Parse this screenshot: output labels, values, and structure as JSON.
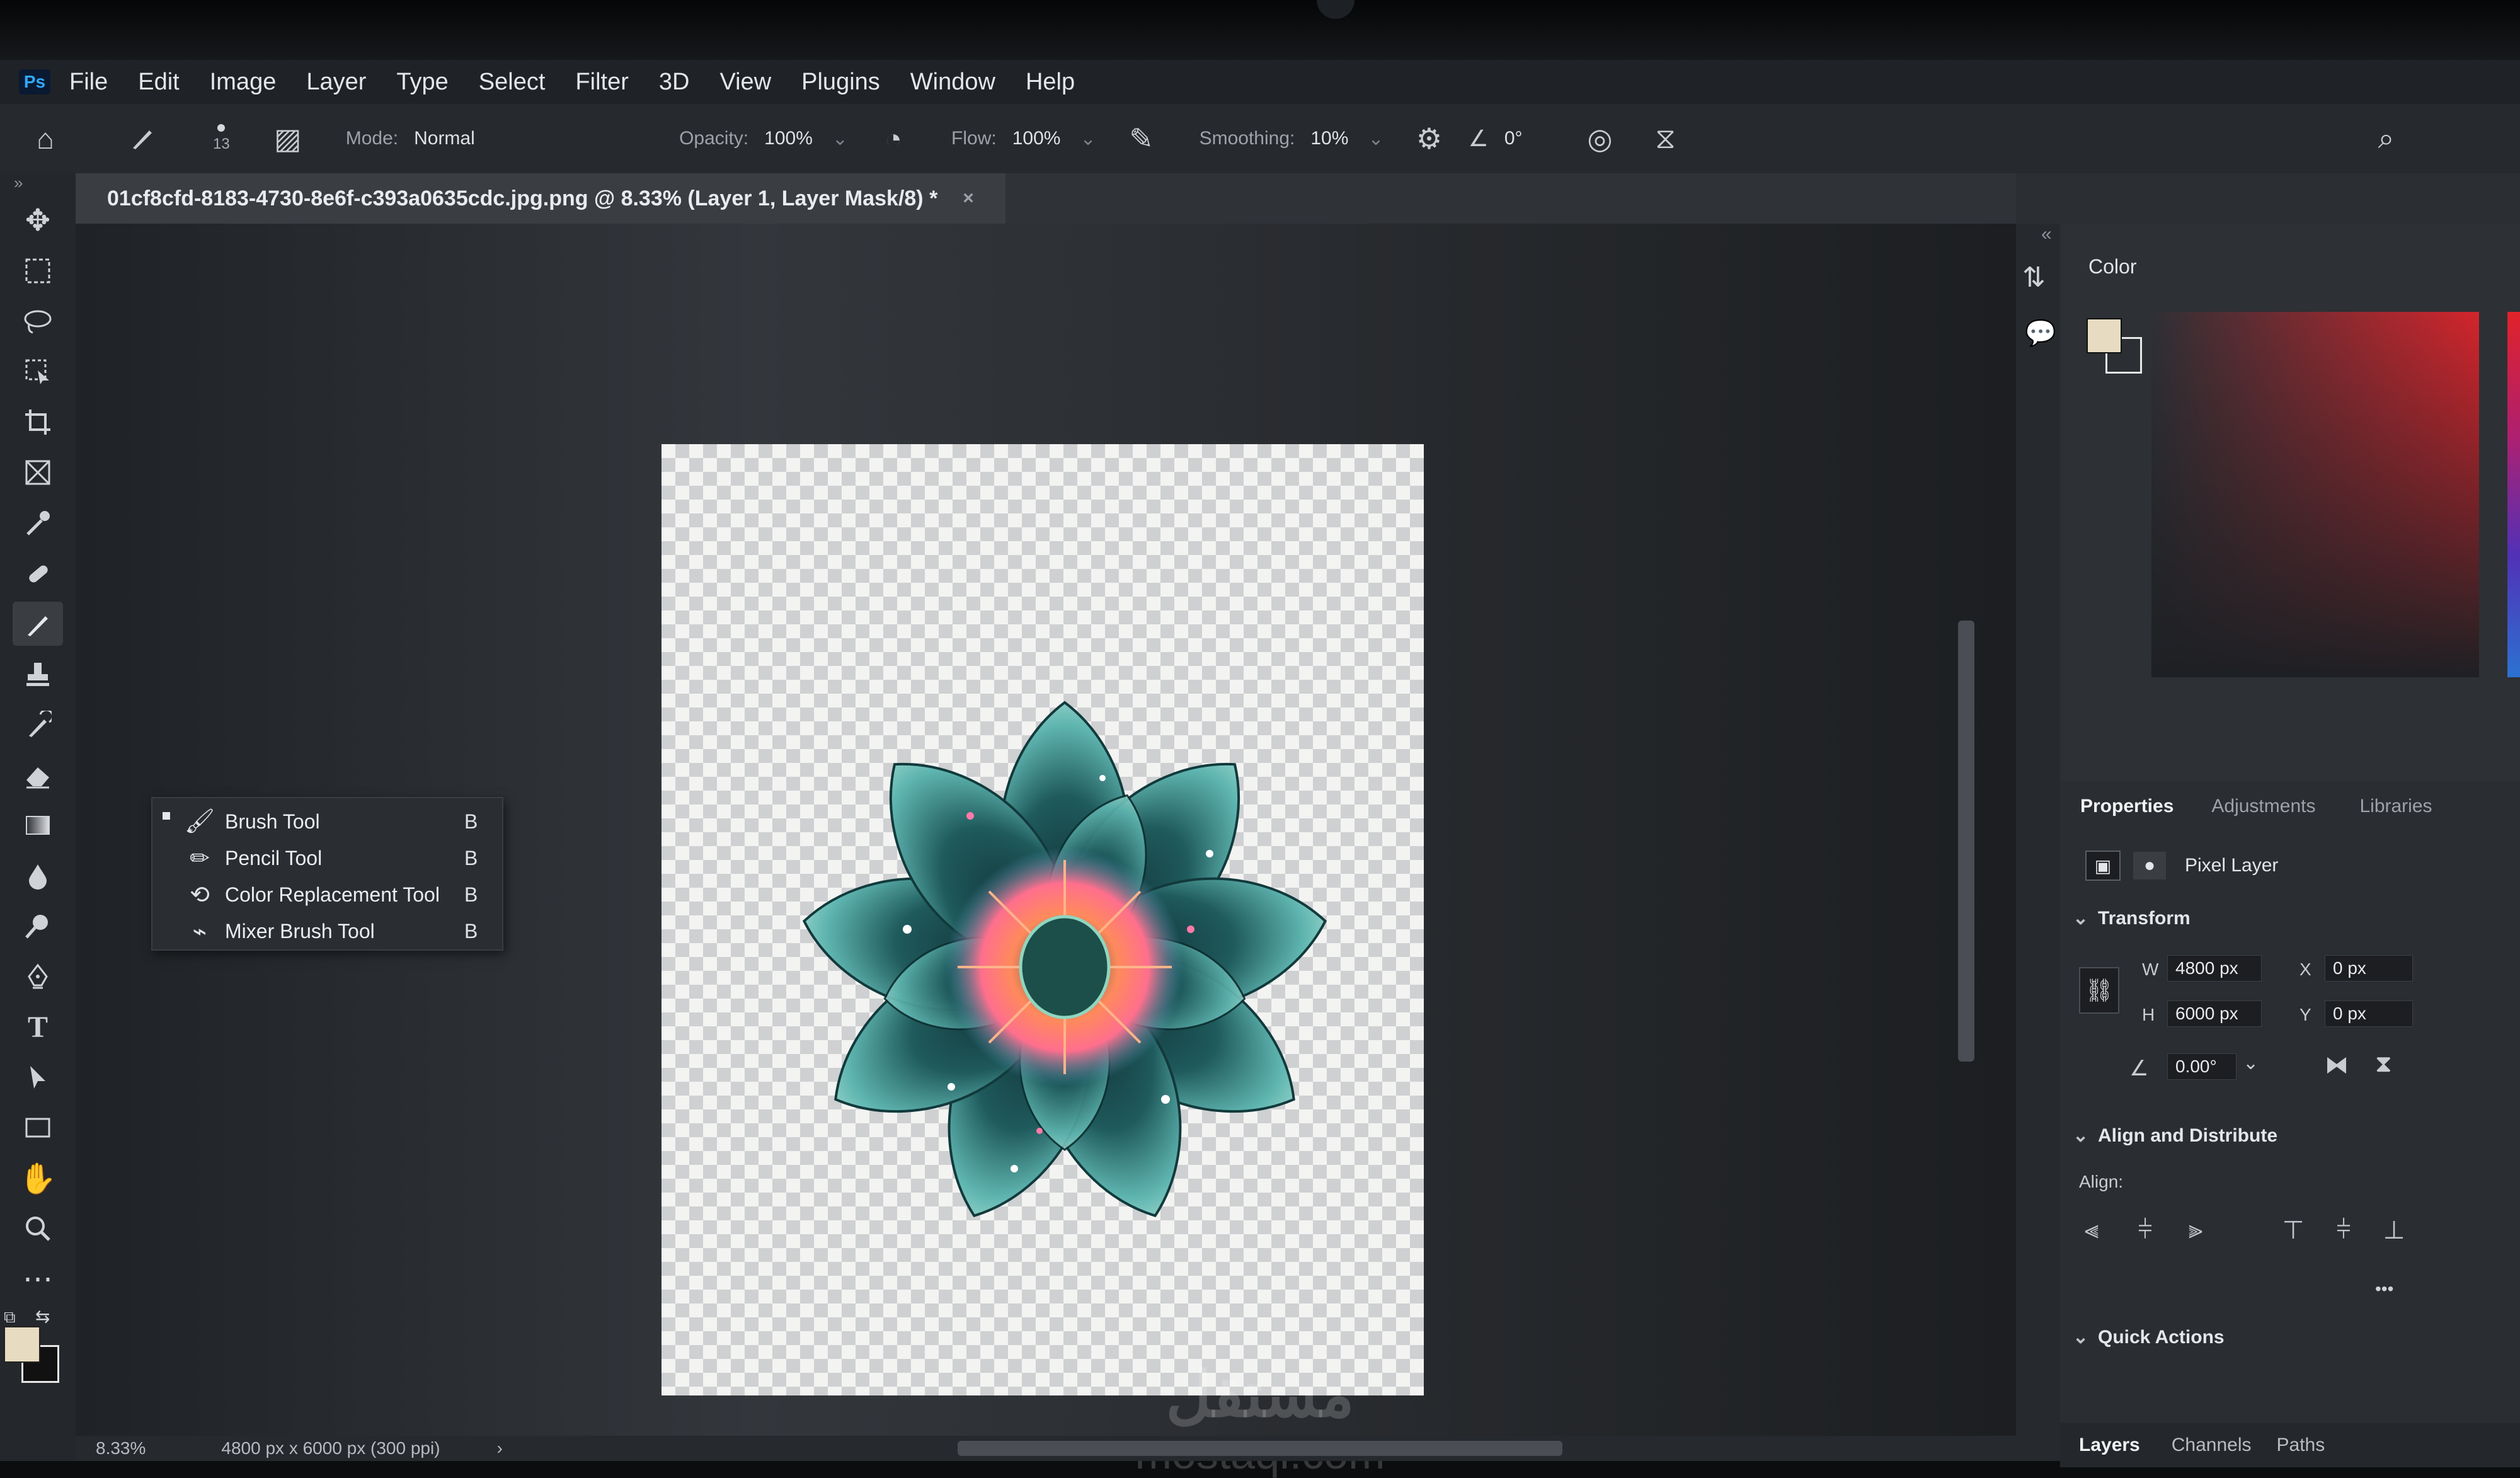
{
  "app": {
    "logo_text": "Ps"
  },
  "menu": [
    "File",
    "Edit",
    "Image",
    "Layer",
    "Type",
    "Select",
    "Filter",
    "3D",
    "View",
    "Plugins",
    "Window",
    "Help"
  ],
  "options": {
    "brush_size": "13",
    "mode_label": "Mode:",
    "mode_value": "Normal",
    "opacity_label": "Opacity:",
    "opacity_value": "100%",
    "flow_label": "Flow:",
    "flow_value": "100%",
    "smoothing_label": "Smoothing:",
    "smoothing_value": "10%",
    "angle_value": "0°"
  },
  "document": {
    "tab_title": "01cf8cfd-8183-4730-8e6f-c393a0635cdc.jpg.png @ 8.33% (Layer 1, Layer Mask/8) *",
    "close_symbol": "×"
  },
  "flyout": [
    {
      "label": "Brush Tool",
      "key": "B",
      "icon": "brush-icon"
    },
    {
      "label": "Pencil Tool",
      "key": "B",
      "icon": "pencil-icon"
    },
    {
      "label": "Color Replacement Tool",
      "key": "B",
      "icon": "color-replacement-icon"
    },
    {
      "label": "Mixer Brush Tool",
      "key": "B",
      "icon": "mixer-brush-icon"
    }
  ],
  "status": {
    "zoom": "8.33%",
    "doc_info": "4800 px x 6000 px (300 ppi)"
  },
  "color_panel": {
    "title": "Color",
    "foreground": "#e7dcc1",
    "background": "#2b2e33"
  },
  "properties": {
    "tabs": [
      "Properties",
      "Adjustments",
      "Libraries"
    ],
    "layer_type": "Pixel Layer",
    "transform_title": "Transform",
    "w_label": "W",
    "w_value": "4800 px",
    "h_label": "H",
    "h_value": "6000 px",
    "x_label": "X",
    "x_value": "0 px",
    "y_label": "Y",
    "y_value": "0 px",
    "angle_value": "0.00°",
    "align_title": "Align and Distribute",
    "align_label": "Align:",
    "more_symbol": "•••",
    "quick_actions_title": "Quick Actions"
  },
  "bottom_tabs": [
    "Layers",
    "Channels",
    "Paths"
  ],
  "watermark": {
    "arabic": "مستقل",
    "latin": "mostaql.com"
  }
}
